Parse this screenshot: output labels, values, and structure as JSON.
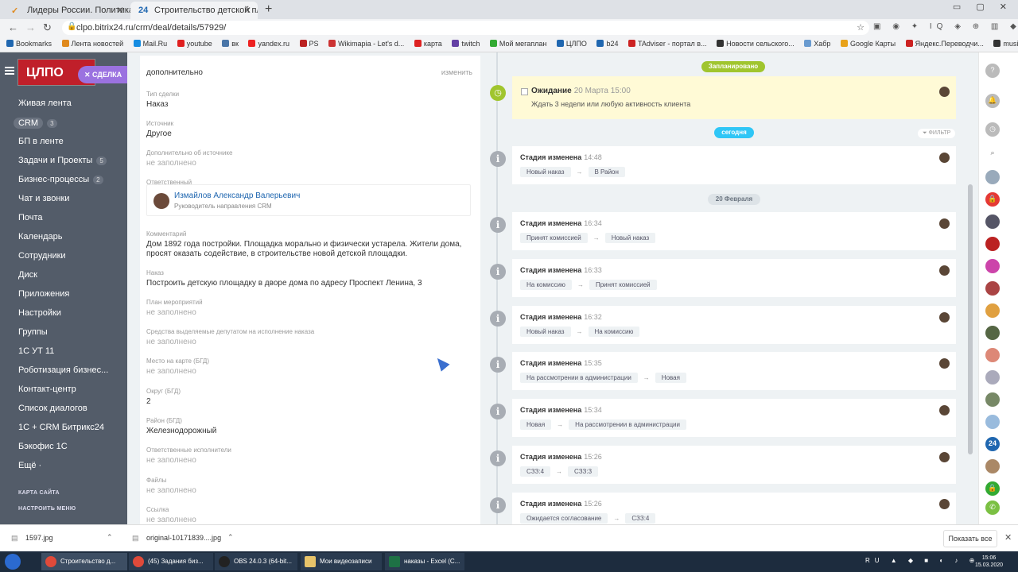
{
  "browser": {
    "tabs": [
      {
        "label": "Лидеры России. Политика",
        "icon": "check-favicon",
        "active": false
      },
      {
        "label": "Строительство детской площад",
        "icon": "bitrix24-favicon",
        "active": true
      }
    ],
    "url": "clpo.bitrix24.ru/crm/deal/details/57929/",
    "bookmarks": [
      "Bookmarks",
      "Лента новостей",
      "Mail.Ru",
      "youtube",
      "вк",
      "yandex.ru",
      "PS",
      "Wikimapia - Let's d...",
      "карта",
      "twitch",
      "Мой мегаплан",
      "ЦЛПО",
      "b24",
      "TAdviser - портал в...",
      "Новости сельского...",
      "Хабр",
      "Google Карты",
      "Яндекс.Переводчи...",
      "music"
    ]
  },
  "sidebar": {
    "logo_text": "ЦЛПО",
    "deal_chip": "СДЕЛКА",
    "items": [
      {
        "label": "Живая лента",
        "count": ""
      },
      {
        "label": "CRM",
        "count": "3"
      },
      {
        "label": "БП в ленте",
        "count": ""
      },
      {
        "label": "Задачи и Проекты",
        "count": "5"
      },
      {
        "label": "Бизнес-процессы",
        "count": "2"
      },
      {
        "label": "Чат и звонки",
        "count": ""
      },
      {
        "label": "Почта",
        "count": ""
      },
      {
        "label": "Календарь",
        "count": ""
      },
      {
        "label": "Сотрудники",
        "count": ""
      },
      {
        "label": "Диск",
        "count": ""
      },
      {
        "label": "Приложения",
        "count": ""
      },
      {
        "label": "Настройки",
        "count": ""
      },
      {
        "label": "Группы",
        "count": ""
      },
      {
        "label": "1С УТ 11",
        "count": ""
      },
      {
        "label": "Роботизация бизнес...",
        "count": ""
      },
      {
        "label": "Контакт-центр",
        "count": ""
      },
      {
        "label": "Список диалогов",
        "count": ""
      },
      {
        "label": "1С + CRM Битрикс24",
        "count": ""
      },
      {
        "label": "Бэкофис 1С",
        "count": ""
      },
      {
        "label": "Ещё ·",
        "count": ""
      }
    ],
    "footer": [
      "КАРТА САЙТА",
      "НАСТРОИТЬ МЕНЮ"
    ]
  },
  "details": {
    "section_title": "дополнительно",
    "edit_label": "изменить",
    "responsible_label": "Ответственный",
    "responsible_name": "Измайлов Александр Валерьевич",
    "responsible_position": "Руководитель направления CRM",
    "fields": [
      {
        "label": "Тип сделки",
        "value": "Наказ",
        "empty": false
      },
      {
        "label": "Источник",
        "value": "Другое",
        "empty": false
      },
      {
        "label": "Дополнительно об источнике",
        "value": "не заполнено",
        "empty": true
      },
      {
        "label": "Комментарий",
        "value": "Дом 1892 года постройки. Площадка морально и физически устарела. Жители дома, просят оказать содействие, в строительстве новой детской площадки.",
        "empty": false
      },
      {
        "label": "Наказ",
        "value": "Построить детскую площадку в дворе дома по адресу Проспект Ленина, 3",
        "empty": false
      },
      {
        "label": "План мероприятий",
        "value": "не заполнено",
        "empty": true
      },
      {
        "label": "Средства выделяемые депутатом на исполнение наказа",
        "value": "не заполнено",
        "empty": true
      },
      {
        "label": "Место на карте (БГД)",
        "value": "не заполнено",
        "empty": true
      },
      {
        "label": "Округ (БГД)",
        "value": "2",
        "empty": false
      },
      {
        "label": "Район (БГД)",
        "value": "Железнодорожный",
        "empty": false
      },
      {
        "label": "Ответственные исполнители",
        "value": "не заполнено",
        "empty": true
      },
      {
        "label": "Файлы",
        "value": "не заполнено",
        "empty": true
      },
      {
        "label": "Ссылка",
        "value": "не заполнено",
        "empty": true
      }
    ]
  },
  "timeline": {
    "planned_label": "Запланировано",
    "today_label": "сегодня",
    "filter_label": "ФИЛЬТР",
    "date_divider": "20 Февраля",
    "waiting": {
      "title": "Ожидание",
      "date": "20 Марта 15:00",
      "text": "Ждать 3 недели или любую активность клиента"
    },
    "events": [
      {
        "title": "Стадия изменена",
        "time": "14:48",
        "from": "Новый наказ",
        "to": "В Район"
      },
      {
        "title": "Стадия изменена",
        "time": "16:34",
        "from": "Принят комиссией",
        "to": "Новый наказ"
      },
      {
        "title": "Стадия изменена",
        "time": "16:33",
        "from": "На комиссию",
        "to": "Принят комиссией"
      },
      {
        "title": "Стадия изменена",
        "time": "16:32",
        "from": "Новый наказ",
        "to": "На комиссию"
      },
      {
        "title": "Стадия изменена",
        "time": "15:35",
        "from": "На рассмотрении в администрации",
        "to": "Новая"
      },
      {
        "title": "Стадия изменена",
        "time": "15:34",
        "from": "Новая",
        "to": "На рассмотрении в администрации"
      },
      {
        "title": "Стадия изменена",
        "time": "15:26",
        "from": "СЗЗ:4",
        "to": "СЗЗ:3"
      },
      {
        "title": "Стадия изменена",
        "time": "15:26",
        "from": "Ожидается согласование",
        "to": "СЗЗ:4"
      }
    ],
    "colors": {
      "planned": "#a0c52e",
      "today": "#2fc6f6",
      "waiting_bg": "#fffad6"
    }
  },
  "downloads": {
    "items": [
      "1597.jpg",
      "original-10171839....jpg"
    ],
    "show_all": "Показать все"
  },
  "taskbar": {
    "items": [
      "Строительство д...",
      "(45) Задания биз...",
      "OBS 24.0.3 (64-bit...",
      "Мои видеозаписи",
      "наказы - Excel (С..."
    ],
    "lang": "RU",
    "time": "15:06",
    "date": "15.03.2020"
  }
}
